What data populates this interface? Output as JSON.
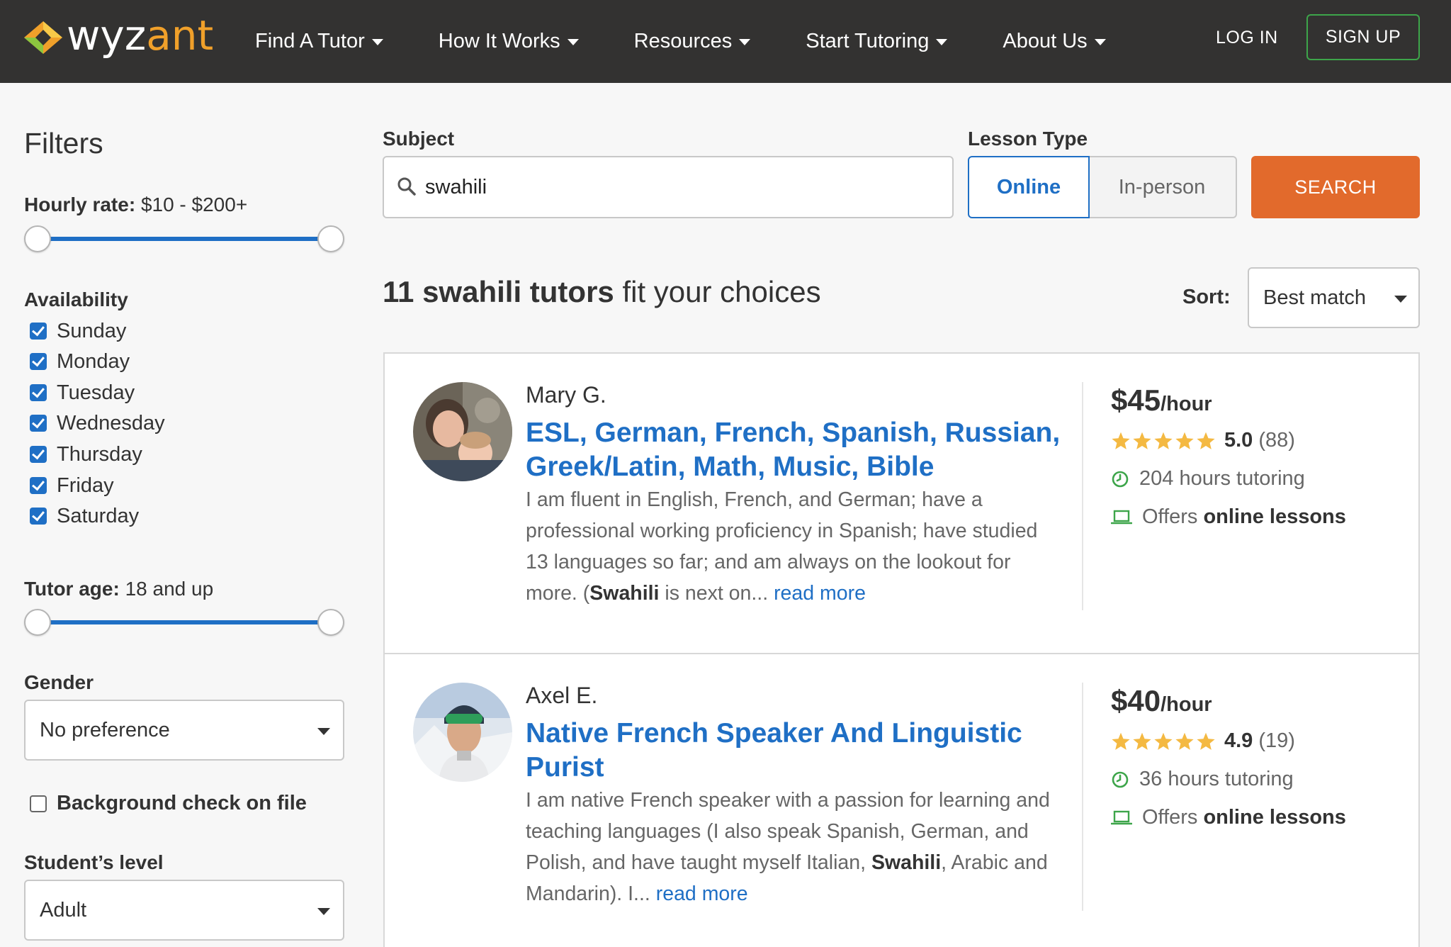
{
  "header": {
    "logo_text_main": "wyz",
    "logo_text_accent": "ant",
    "nav": [
      "Find A Tutor",
      "How It Works",
      "Resources",
      "Start Tutoring",
      "About Us"
    ],
    "login": "LOG IN",
    "signup": "SIGN UP"
  },
  "filters": {
    "title": "Filters",
    "hourly_label": "Hourly rate:",
    "hourly_value": "$10 - $200+",
    "availability_title": "Availability",
    "days": [
      "Sunday",
      "Monday",
      "Tuesday",
      "Wednesday",
      "Thursday",
      "Friday",
      "Saturday"
    ],
    "age_label": "Tutor age:",
    "age_value": "18 and up",
    "gender_title": "Gender",
    "gender_value": "No preference",
    "bgcheck_label": "Background check on file",
    "level_title": "Student’s level",
    "level_value": "Adult"
  },
  "search": {
    "subject_label": "Subject",
    "subject_value": "swahili",
    "lesson_type_label": "Lesson Type",
    "online": "Online",
    "inperson": "In-person",
    "button": "SEARCH"
  },
  "results": {
    "count_strong": "11 swahili tutors",
    "count_rest": " fit your choices",
    "sort_label": "Sort:",
    "sort_value": "Best match"
  },
  "tutors": [
    {
      "name": "Mary G.",
      "title": "ESL, German, French, Spanish, Russian, Greek/Latin, Math, Music, Bible",
      "desc_start": "I am fluent in English, French, and German; have a professional working proficiency in Spanish; have studied 13 languages so far; and am always on the lookout for more. (",
      "desc_bold": "Swahili",
      "desc_end": " is next on... ",
      "read_more": "read more",
      "price": "$45",
      "per": "/hour",
      "rating": "5.0",
      "reviews": "(88)",
      "hours": "204 hours tutoring",
      "offers": "Offers",
      "offers_bold": "online lessons"
    },
    {
      "name": "Axel E.",
      "title": "Native French Speaker And Linguistic Purist",
      "desc_start": "I am native French speaker with a passion for learning and teaching languages (I also speak Spanish, German, and Polish, and have taught myself Italian, ",
      "desc_bold": "Swahili",
      "desc_end": ", Arabic and Mandarin). I... ",
      "read_more": "read more",
      "price": "$40",
      "per": "/hour",
      "rating": "4.9",
      "reviews": "(19)",
      "hours": "36 hours tutoring",
      "offers": "Offers",
      "offers_bold": "online lessons"
    }
  ],
  "colors": {
    "header_bg": "#333231",
    "accent_blue": "#1f6fc5",
    "search_orange": "#e26a2c",
    "star_gold": "#f4b942",
    "signup_green": "#3da54a"
  }
}
